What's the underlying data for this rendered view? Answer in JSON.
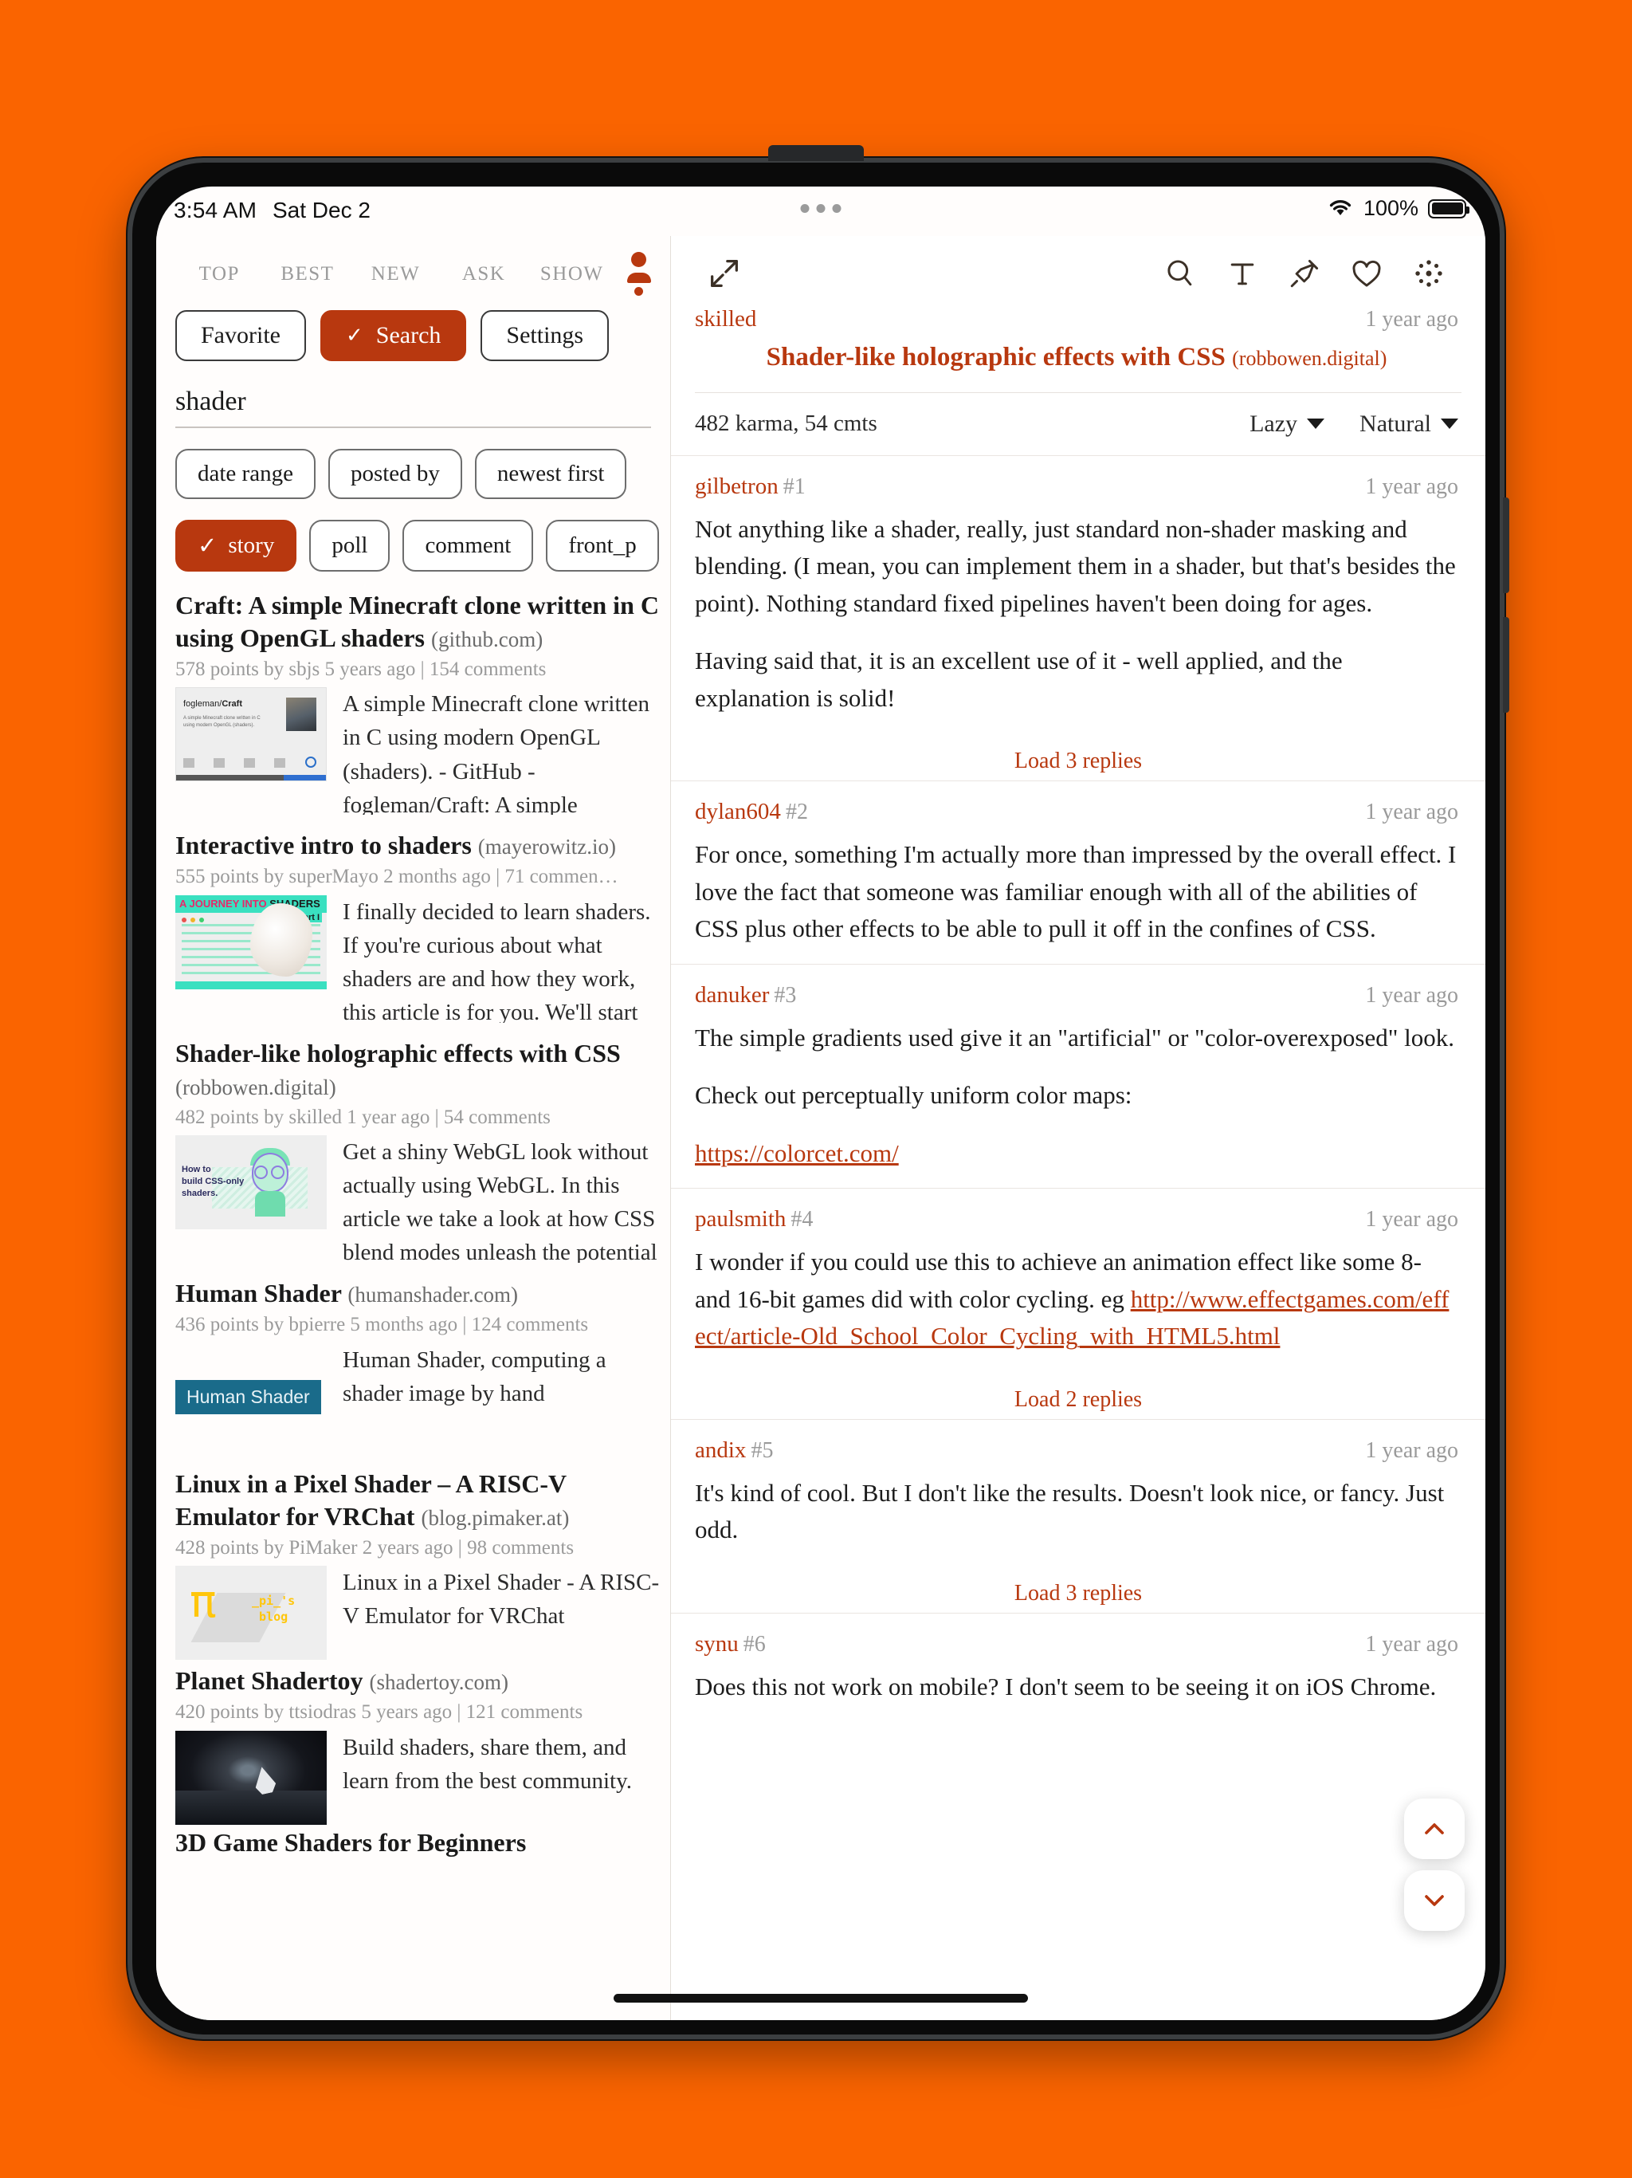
{
  "statusbar": {
    "time": "3:54 AM",
    "date": "Sat Dec 2",
    "battery_pct": "100%",
    "wifi_icon": "wifi-icon",
    "battery_icon": "battery-icon"
  },
  "left": {
    "tabs": [
      {
        "label": "TOP"
      },
      {
        "label": "BEST"
      },
      {
        "label": "NEW"
      },
      {
        "label": "ASK"
      },
      {
        "label": "SHOW"
      }
    ],
    "account_icon": "account-icon",
    "modes": [
      {
        "label": "Favorite",
        "selected": false
      },
      {
        "label": "Search",
        "selected": true,
        "check": "✓"
      },
      {
        "label": "Settings",
        "selected": false
      }
    ],
    "search": {
      "value": "shader",
      "placeholder": "search"
    },
    "filters": [
      {
        "label": "date range",
        "selected": false
      },
      {
        "label": "posted by",
        "selected": false
      },
      {
        "label": "newest first",
        "selected": false
      }
    ],
    "types": [
      {
        "label": "story",
        "selected": true,
        "check": "✓"
      },
      {
        "label": "poll",
        "selected": false
      },
      {
        "label": "comment",
        "selected": false
      },
      {
        "label": "front_p",
        "selected": false
      }
    ],
    "stories": [
      {
        "title": "Craft: A simple Minecraft clone written in C using OpenGL shaders",
        "domain": "(github.com)",
        "meta": "578 points by sbjs 5 years ago | 154 comments",
        "snippet": "A simple Minecraft clone written in C using modern OpenGL (shaders). - GitHub - fogleman/Craft: A simple Minecraft clone written in C …",
        "thumb": "craft-thumbnail"
      },
      {
        "title": "Interactive intro to shaders",
        "domain": "(mayerowitz.io)",
        "meta": "555 points by superMayo 2 months ago | 71 commen…",
        "snippet": "I finally decided to learn shaders. If you're curious about what shaders are and how they work, this article is for you. We'll start with the b…",
        "thumb": "journey-into-shaders-thumbnail"
      },
      {
        "title": "Shader-like holographic effects with CSS",
        "domain": "(robbowen.digital)",
        "meta": "482 points by skilled 1 year ago | 54 comments",
        "snippet": "Get a shiny WebGL look without actually using WebGL. In this article we take a look at how CSS blend modes unleash the potential of cool composit…",
        "thumb": "css-shaders-thumbnail"
      },
      {
        "title": "Human Shader",
        "domain": "(humanshader.com)",
        "meta": "436 points by bpierre 5 months ago | 124 comments",
        "snippet": "Human Shader, computing a shader image by hand",
        "thumb": "human-shader-tag",
        "tag": "Human Shader"
      },
      {
        "title": "Linux in a Pixel Shader – A RISC-V Emulator for VRChat",
        "domain": "(blog.pimaker.at)",
        "meta": "428 points by PiMaker 2 years ago | 98 comments",
        "snippet": "Linux in a Pixel Shader - A RISC-V Emulator for VRChat",
        "thumb": "pi-blog-thumbnail"
      },
      {
        "title": "Planet Shadertoy",
        "domain": "(shadertoy.com)",
        "meta": "420 points by ttsiodras 5 years ago | 121 comments",
        "snippet": "Build shaders, share them, and learn from the best community.",
        "thumb": "planet-shadertoy-thumbnail"
      },
      {
        "title": "3D Game Shaders for Beginners",
        "domain": "",
        "meta": "",
        "snippet": "",
        "thumb": ""
      }
    ]
  },
  "right": {
    "toolbar": {
      "expand_icon": "expand-icon",
      "icons": [
        {
          "name": "search-icon"
        },
        {
          "name": "text-size-icon"
        },
        {
          "name": "pin-icon"
        },
        {
          "name": "heart-icon"
        },
        {
          "name": "sparkle-icon"
        }
      ]
    },
    "story": {
      "user": "skilled",
      "ago": "1 year ago",
      "title": "Shader-like holographic effects with CSS",
      "domain": "(robbowen.digital)"
    },
    "subbar": {
      "karma": "482 karma, 54 cmts",
      "sort_label": "Lazy",
      "order_label": "Natural",
      "caret_icon": "chevron-down-icon"
    },
    "comments": [
      {
        "user": "gilbetron",
        "num": "#1",
        "ago": "1 year ago",
        "paragraphs": [
          "Not anything like a shader, really, just standard non-shader masking and blending. (I mean, you can implement them in a shader, but that's besides the point). Nothing standard fixed pipelines haven't been doing for ages.",
          "Having said that, it is an excellent use of it - well applied, and the explanation is solid!"
        ],
        "load_replies": "Load 3 replies"
      },
      {
        "user": "dylan604",
        "num": "#2",
        "ago": "1 year ago",
        "paragraphs": [
          "For once, something I'm actually more than impressed by the overall effect. I love the fact that someone was familiar enough with all of the abilities of CSS plus other effects to be able to pull it off in the confines of CSS."
        ],
        "load_replies": ""
      },
      {
        "user": "danuker",
        "num": "#3",
        "ago": "1 year ago",
        "paragraphs": [
          "The simple gradients used give it an \"artificial\" or \"color-overexposed\" look.",
          "Check out perceptually uniform color maps:"
        ],
        "link": "https://colorcet.com/",
        "load_replies": ""
      },
      {
        "user": "paulsmith",
        "num": "#4",
        "ago": "1 year ago",
        "paragraphs": [
          "I wonder if you could use this to achieve an animation effect like some 8- and 16-bit games did with color cycling. eg "
        ],
        "link": "http://www.effectgames.com/effect/article-Old_School_Color_Cycling_with_HTML5.html",
        "inline_link": true,
        "load_replies": "Load 2 replies"
      },
      {
        "user": "andix",
        "num": "#5",
        "ago": "1 year ago",
        "paragraphs": [
          "It's kind of cool. But I don't like the results. Doesn't look nice, or fancy. Just odd."
        ],
        "load_replies": "Load 3 replies"
      },
      {
        "user": "synu",
        "num": "#6",
        "ago": "1 year ago",
        "paragraphs": [
          "Does this not work on mobile? I don't seem to be seeing it on iOS Chrome."
        ],
        "load_replies": ""
      }
    ],
    "fabs": [
      {
        "name": "scroll-up-button",
        "icon": "chevron-up-icon"
      },
      {
        "name": "scroll-down-button",
        "icon": "chevron-down-icon"
      }
    ]
  },
  "colors": {
    "accent": "#b8380f",
    "background": "#FA6400",
    "muted": "#9a9a9a"
  }
}
